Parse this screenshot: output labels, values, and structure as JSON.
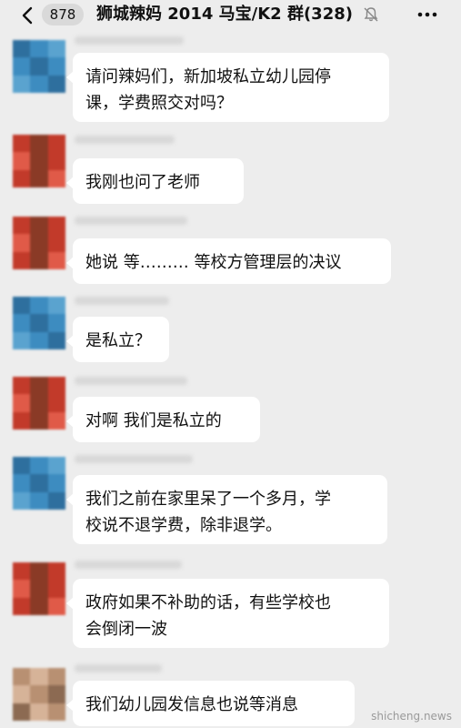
{
  "header": {
    "unread_count": "878",
    "title": "狮城辣妈 2014 马宝/K2 群(328)",
    "back_icon": "chevron-left-icon",
    "mute_icon": "bell-muted-icon",
    "more_icon": "more-dots-icon"
  },
  "messages": [
    {
      "avatar": "blue",
      "lines": [
        "请问辣妈们，新加坡私立幼儿园停",
        "课，学费照交对吗？"
      ]
    },
    {
      "avatar": "red",
      "lines": [
        "我刚也问了老师"
      ]
    },
    {
      "avatar": "red",
      "lines": [
        "她说 等……… 等校方管理层的决议"
      ]
    },
    {
      "avatar": "blue",
      "lines": [
        "是私立？"
      ]
    },
    {
      "avatar": "red",
      "lines": [
        "对啊 我们是私立的"
      ]
    },
    {
      "avatar": "blue",
      "lines": [
        "我们之前在家里呆了一个多月，学",
        "校说不退学费，除非退学。"
      ]
    },
    {
      "avatar": "red",
      "lines": [
        "政府如果不补助的话，有些学校也",
        "会倒闭一波"
      ]
    },
    {
      "avatar": "tan",
      "lines": [
        "我们幼儿园发信息也说等消息"
      ]
    }
  ],
  "watermark": "shicheng.news",
  "colors": {
    "background": "#ededed",
    "bubble": "#ffffff",
    "avatar_blue": [
      "#2e6f9e",
      "#3d8cc0",
      "#5aa3cf"
    ],
    "avatar_red": [
      "#c23a2a",
      "#8a3a26",
      "#e05a48"
    ],
    "avatar_tan": [
      "#b89072",
      "#d6b398",
      "#8c6a52"
    ]
  }
}
